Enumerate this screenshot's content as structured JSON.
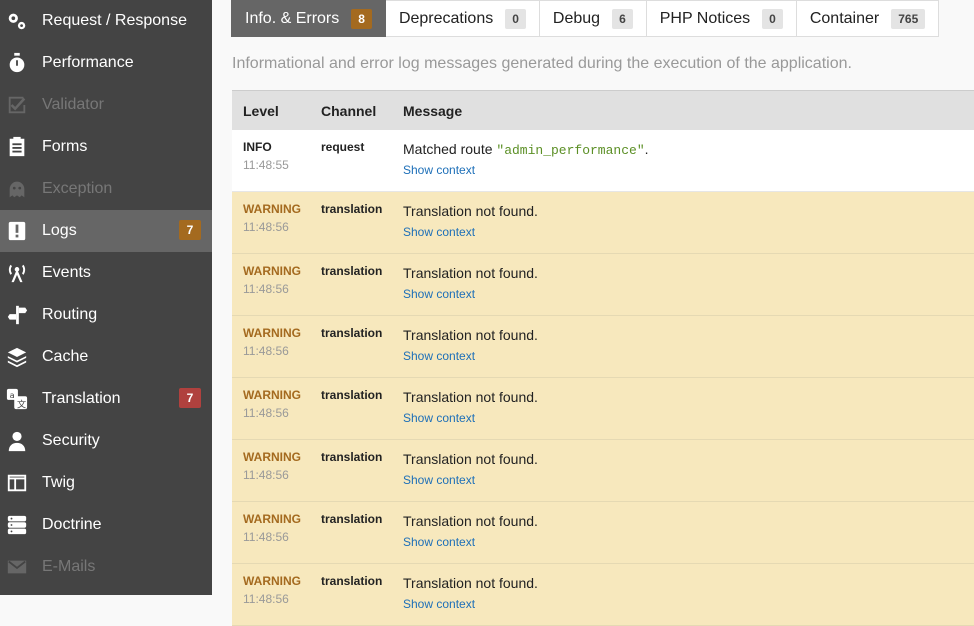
{
  "sidebar": {
    "items": [
      {
        "label": "Request / Response",
        "icon": "gears-icon",
        "state": "normal"
      },
      {
        "label": "Performance",
        "icon": "stopwatch-icon",
        "state": "normal"
      },
      {
        "label": "Validator",
        "icon": "checkbox-icon",
        "state": "disabled"
      },
      {
        "label": "Forms",
        "icon": "clipboard-icon",
        "state": "normal"
      },
      {
        "label": "Exception",
        "icon": "ghost-icon",
        "state": "disabled"
      },
      {
        "label": "Logs",
        "icon": "exclamation-icon",
        "state": "selected",
        "count": "7",
        "count_type": "warning"
      },
      {
        "label": "Events",
        "icon": "antenna-icon",
        "state": "normal"
      },
      {
        "label": "Routing",
        "icon": "signpost-icon",
        "state": "normal"
      },
      {
        "label": "Cache",
        "icon": "layers-icon",
        "state": "normal"
      },
      {
        "label": "Translation",
        "icon": "translate-icon",
        "state": "normal",
        "count": "7",
        "count_type": "error"
      },
      {
        "label": "Security",
        "icon": "user-icon",
        "state": "normal"
      },
      {
        "label": "Twig",
        "icon": "template-icon",
        "state": "normal"
      },
      {
        "label": "Doctrine",
        "icon": "database-icon",
        "state": "normal"
      },
      {
        "label": "E-Mails",
        "icon": "envelope-icon",
        "state": "disabled"
      }
    ]
  },
  "tabs": [
    {
      "label": "Info. & Errors",
      "count": "8",
      "active": true
    },
    {
      "label": "Deprecations",
      "count": "0",
      "active": false
    },
    {
      "label": "Debug",
      "count": "6",
      "active": false
    },
    {
      "label": "PHP Notices",
      "count": "0",
      "active": false
    },
    {
      "label": "Container",
      "count": "765",
      "active": false
    }
  ],
  "intro": "Informational and error log messages generated during the execution of the application.",
  "table": {
    "headers": {
      "level": "Level",
      "channel": "Channel",
      "message": "Message"
    },
    "context_link": "Show context",
    "rows": [
      {
        "level": "INFO",
        "time": "11:48:55",
        "channel": "request",
        "message_prefix": "Matched route ",
        "message_code": "\"admin_performance\"",
        "message_suffix": ".",
        "type": "info"
      },
      {
        "level": "WARNING",
        "time": "11:48:56",
        "channel": "translation",
        "message_prefix": "Translation not found.",
        "message_code": "",
        "message_suffix": "",
        "type": "warning"
      },
      {
        "level": "WARNING",
        "time": "11:48:56",
        "channel": "translation",
        "message_prefix": "Translation not found.",
        "message_code": "",
        "message_suffix": "",
        "type": "warning"
      },
      {
        "level": "WARNING",
        "time": "11:48:56",
        "channel": "translation",
        "message_prefix": "Translation not found.",
        "message_code": "",
        "message_suffix": "",
        "type": "warning"
      },
      {
        "level": "WARNING",
        "time": "11:48:56",
        "channel": "translation",
        "message_prefix": "Translation not found.",
        "message_code": "",
        "message_suffix": "",
        "type": "warning"
      },
      {
        "level": "WARNING",
        "time": "11:48:56",
        "channel": "translation",
        "message_prefix": "Translation not found.",
        "message_code": "",
        "message_suffix": "",
        "type": "warning"
      },
      {
        "level": "WARNING",
        "time": "11:48:56",
        "channel": "translation",
        "message_prefix": "Translation not found.",
        "message_code": "",
        "message_suffix": "",
        "type": "warning"
      },
      {
        "level": "WARNING",
        "time": "11:48:56",
        "channel": "translation",
        "message_prefix": "Translation not found.",
        "message_code": "",
        "message_suffix": "",
        "type": "warning"
      }
    ]
  },
  "colors": {
    "sidebar_bg": "#444444",
    "selected_bg": "#666666",
    "warning_bg": "#f7e8bd",
    "warning_text": "#a46a1f",
    "error_badge": "#b0413e",
    "link": "#1d6fb8"
  }
}
